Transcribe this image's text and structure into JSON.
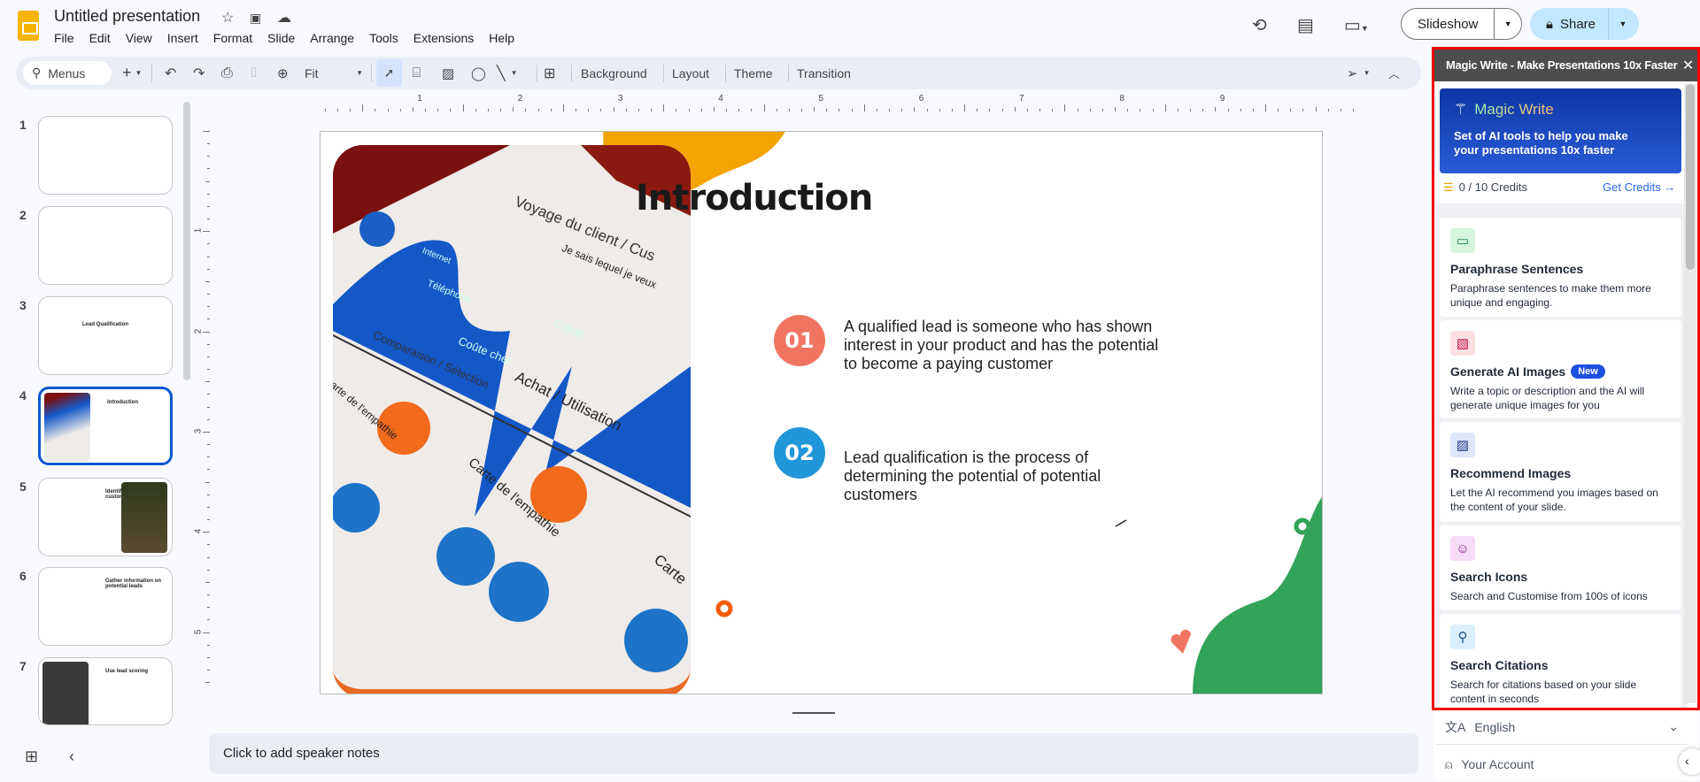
{
  "app": {
    "title": "Untitled presentation",
    "menus": [
      "File",
      "Edit",
      "View",
      "Insert",
      "Format",
      "Slide",
      "Arrange",
      "Tools",
      "Extensions",
      "Help"
    ]
  },
  "header": {
    "slideshow_label": "Slideshow",
    "share_label": "Share"
  },
  "toolbar": {
    "search_label": "Menus",
    "zoom_value": "Fit",
    "background": "Background",
    "layout": "Layout",
    "theme": "Theme",
    "transition": "Transition"
  },
  "ruler": {
    "h_labels": [
      "1",
      "2",
      "3",
      "4",
      "5",
      "6",
      "7",
      "8",
      "9"
    ],
    "v_labels": [
      "1",
      "2",
      "3",
      "4",
      "5"
    ]
  },
  "filmstrip": {
    "selected": 4,
    "slides": [
      {
        "num": "1",
        "title": ""
      },
      {
        "num": "2",
        "title": ""
      },
      {
        "num": "3",
        "title": "Lead Qualification"
      },
      {
        "num": "4",
        "title": "Introduction"
      },
      {
        "num": "5",
        "title": "Identify your ideal customer"
      },
      {
        "num": "6",
        "title": "Gather information on potential leads"
      },
      {
        "num": "7",
        "title": "Use lead scoring"
      }
    ]
  },
  "slide": {
    "title": "Introduction",
    "points": [
      {
        "num": "01",
        "text": "A qualified lead is someone who has shown interest in your product and has the potential to become a paying customer",
        "color": "#f07561"
      },
      {
        "num": "02",
        "text": "Lead qualification is the process of determining the potential of potential customers",
        "color": "#2196d9"
      }
    ],
    "photo_text": [
      "Voyage du client / Cus",
      "Je sais lequel je veux",
      "Internet",
      "Téléphone",
      "Coûte cher",
      "Crédit",
      "Comparaison / Sélection",
      "Achat / Utilisation",
      "Carte de l'empathie",
      "Carte de l'empathie",
      "Carte"
    ]
  },
  "notes": {
    "placeholder": "Click to add speaker notes"
  },
  "panel": {
    "header": "Magic Write - Make Presentations 10x Faster",
    "banner_title": "Magic Write",
    "banner_text": "Set of AI tools to help you make your presentations 10x faster",
    "credits": "0 / 10 Credits",
    "get_credits": "Get Credits",
    "tools": [
      {
        "name": "Paraphrase Sentences",
        "desc": "Paraphrase sentences to make them more unique and engaging.",
        "icon": "chat-icon",
        "badge": ""
      },
      {
        "name": "Generate AI Images",
        "desc": "Write a topic or description and the AI will generate unique images for you",
        "icon": "ai-image-icon",
        "badge": "New"
      },
      {
        "name": "Recommend Images",
        "desc": "Let the AI recommend you images based on the content of your slide.",
        "icon": "image-icon",
        "badge": ""
      },
      {
        "name": "Search Icons",
        "desc": "Search and Customise from 100s of icons",
        "icon": "smiley-icon",
        "badge": ""
      },
      {
        "name": "Search Citations",
        "desc": "Search for citations based on your slide content in seconds",
        "icon": "search-icon",
        "badge": ""
      }
    ],
    "language": "English",
    "account": "Your Account"
  },
  "colors": {
    "accent": "#0b57d0",
    "share_bg": "#c2e7ff",
    "highlight_border": "#f20000",
    "orange": "#f5a300",
    "green": "#34a35a"
  }
}
